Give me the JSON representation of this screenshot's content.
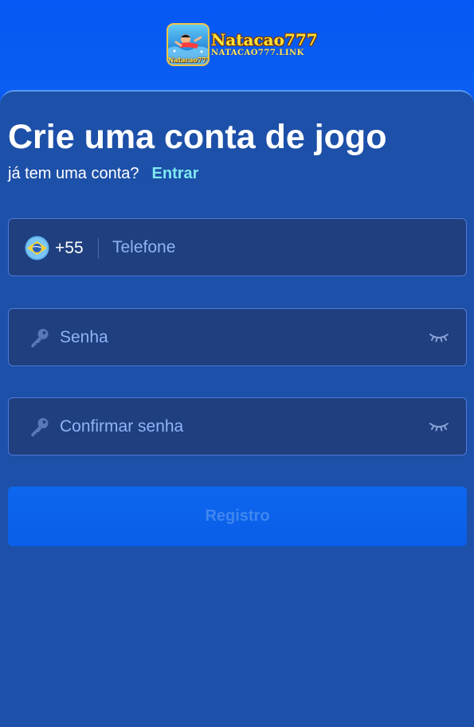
{
  "brand": {
    "badge_text": "Natacao777",
    "title": "Natacao777",
    "subtitle": "NATACAO777.LINK",
    "gold": "#ffe23a"
  },
  "page": {
    "title": "Crie uma conta de jogo",
    "has_account_text": "já tem uma conta?",
    "login_link": "Entrar"
  },
  "form": {
    "phone": {
      "country_code": "+55",
      "flag_icon": "brazil-flag-icon",
      "placeholder": "Telefone",
      "value": ""
    },
    "password": {
      "icon": "key-icon",
      "placeholder": "Senha",
      "value": "",
      "toggle_icon": "eye-closed-icon"
    },
    "confirm_password": {
      "icon": "key-icon",
      "placeholder": "Confirmar senha",
      "value": "",
      "toggle_icon": "eye-closed-icon"
    },
    "submit_label": "Registro"
  },
  "colors": {
    "header_bg": "#0757f4",
    "panel_bg": "#1d50a8",
    "field_bg": "#1f3f7e",
    "link": "#7fe8f2",
    "button_bg": "#0d66ee"
  }
}
